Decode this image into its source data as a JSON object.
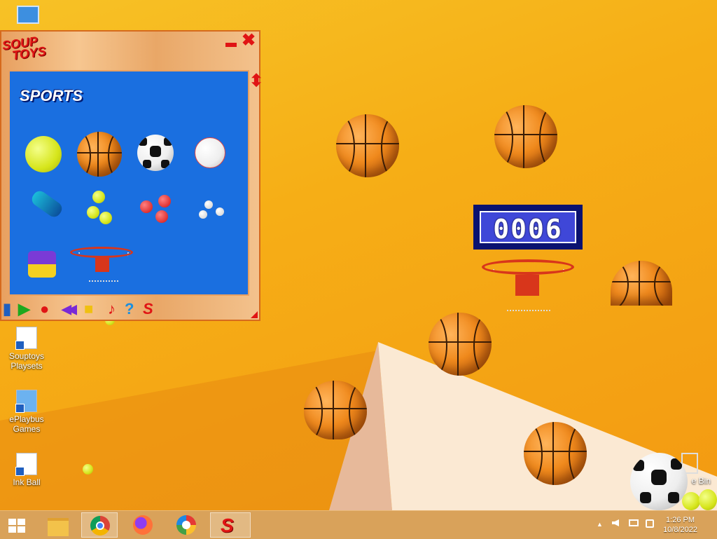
{
  "desktop": {
    "icons": [
      {
        "label_line1": "Souptoys",
        "label_line2": "Playsets"
      },
      {
        "label_line1": "ePlaybus",
        "label_line2": "Games"
      },
      {
        "label_line1": "Ink Ball",
        "label_line2": ""
      },
      {
        "label_line1": "e Bin",
        "label_line2": ""
      }
    ]
  },
  "app_window": {
    "logo_line1": "SOUP",
    "logo_line2": "TOYS",
    "minimize_symbol": "▬",
    "close_symbol": "✖",
    "scroll_symbol": "⬍",
    "category_title": "SPORTS",
    "toys": [
      {
        "icon": "tennis-ball-icon"
      },
      {
        "icon": "basketball-icon"
      },
      {
        "icon": "soccer-ball-icon"
      },
      {
        "icon": "baseball-icon"
      },
      {
        "icon": "sneaker-icon"
      },
      {
        "icon": "tennis-balls-icon"
      },
      {
        "icon": "red-balls-icon"
      },
      {
        "icon": "white-balls-icon"
      },
      {
        "icon": "roller-skate-icon"
      },
      {
        "icon": "basketball-hoop-icon"
      }
    ],
    "toolbar": {
      "info_symbol": "▮",
      "play_symbol": "▶",
      "stop_symbol": "●",
      "rewind_symbol": "◀◀",
      "folder_symbol": "■",
      "music_symbol": "♪",
      "help_symbol": "?",
      "souptoys_symbol": "S"
    }
  },
  "scoreboard": {
    "score": "0006"
  },
  "taskbar": {
    "apps": [
      "start-button",
      "file-explorer",
      "chrome",
      "firefox",
      "vpn-app",
      "souptoys"
    ],
    "souptoys_symbol": "S",
    "tray_up_symbol": "▲",
    "time": "1:26 PM",
    "date": "10/8/2022"
  },
  "colors": {
    "accent_red": "#e01414",
    "panel_blue": "#1a6fe0",
    "scoreboard_blue": "#3f47d8"
  }
}
